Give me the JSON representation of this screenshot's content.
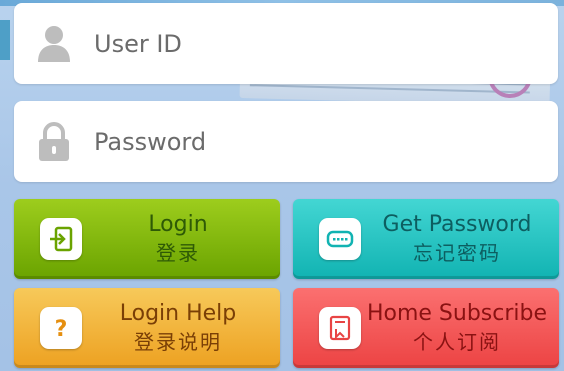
{
  "login_form": {
    "userid": {
      "placeholder": "User ID",
      "icon": "user-icon"
    },
    "password": {
      "placeholder": "Password",
      "icon": "lock-icon"
    }
  },
  "buttons": {
    "login": {
      "label_en": "Login",
      "label_zh": "登录",
      "icon": "enter-icon",
      "color": "#7fb80e"
    },
    "get_password": {
      "label_en": "Get Password",
      "label_zh": "忘记密码",
      "icon": "keyboard-icon",
      "color": "#22c3c1"
    },
    "login_help": {
      "label_en": "Login Help",
      "label_zh": "登录说明",
      "icon": "question-icon",
      "color": "#f2b53e"
    },
    "home_subscribe": {
      "label_en": "Home Subscribe",
      "label_zh": "个人订阅",
      "icon": "bookmark-icon",
      "color": "#f25656"
    }
  }
}
